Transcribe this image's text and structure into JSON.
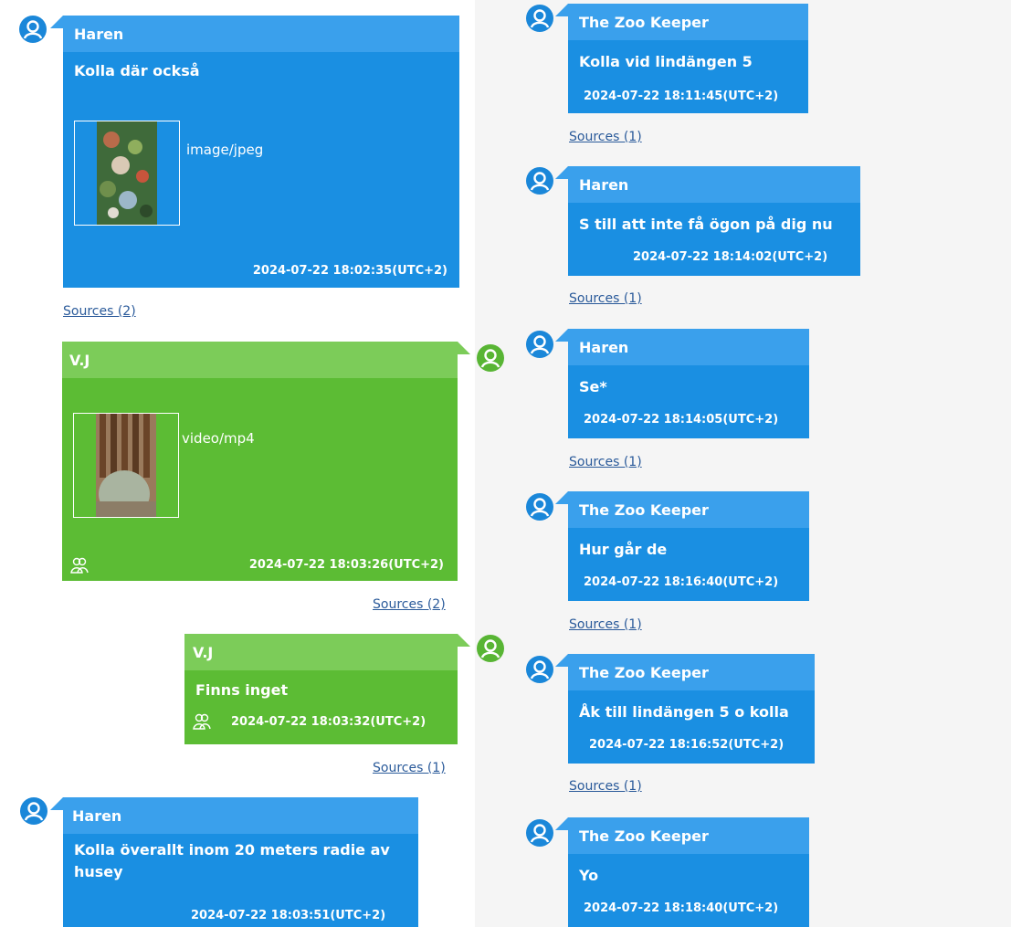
{
  "sources_label": "Sources",
  "left_messages": [
    {
      "sender": "Haren",
      "text": "Kolla där också",
      "attachment_type": "image/jpeg",
      "timestamp": "2024-07-22 18:02:35(UTC+2)",
      "sources": "Sources (2)"
    },
    {
      "sender": "V.J",
      "attachment_type": "video/mp4",
      "timestamp": "2024-07-22 18:03:26(UTC+2)",
      "sources": "Sources (2)"
    },
    {
      "sender": "V.J",
      "text": "Finns inget",
      "timestamp": "2024-07-22 18:03:32(UTC+2)",
      "sources": "Sources (1)"
    },
    {
      "sender": "Haren",
      "text": "Kolla överallt inom 20 meters radie av husey",
      "timestamp": "2024-07-22 18:03:51(UTC+2)"
    }
  ],
  "right_messages": [
    {
      "sender": "The Zoo Keeper",
      "text": "Kolla vid lindängen 5",
      "timestamp": "2024-07-22 18:11:45(UTC+2)",
      "sources": "Sources (1)"
    },
    {
      "sender": "Haren",
      "text": "S till att inte få ögon på dig nu",
      "timestamp": "2024-07-22 18:14:02(UTC+2)",
      "sources": "Sources (1)"
    },
    {
      "sender": "Haren",
      "text": "Se*",
      "timestamp": "2024-07-22 18:14:05(UTC+2)",
      "sources": "Sources (1)"
    },
    {
      "sender": "The Zoo Keeper",
      "text": "Hur går de",
      "timestamp": "2024-07-22 18:16:40(UTC+2)",
      "sources": "Sources (1)"
    },
    {
      "sender": "The Zoo Keeper",
      "text": "Åk till lindängen 5 o kolla",
      "timestamp": "2024-07-22 18:16:52(UTC+2)",
      "sources": "Sources (1)"
    },
    {
      "sender": "The Zoo Keeper",
      "text": "Yo",
      "timestamp": "2024-07-22 18:18:40(UTC+2)"
    }
  ],
  "colors": {
    "incoming_body": "#1a8fe2",
    "incoming_header": "#3aa0ec",
    "outgoing_body": "#5cbc34",
    "outgoing_header": "#7ccc59",
    "link": "#2a5a9a"
  },
  "icons": {
    "avatar": "user-avatar-icon",
    "group": "group-icon"
  }
}
